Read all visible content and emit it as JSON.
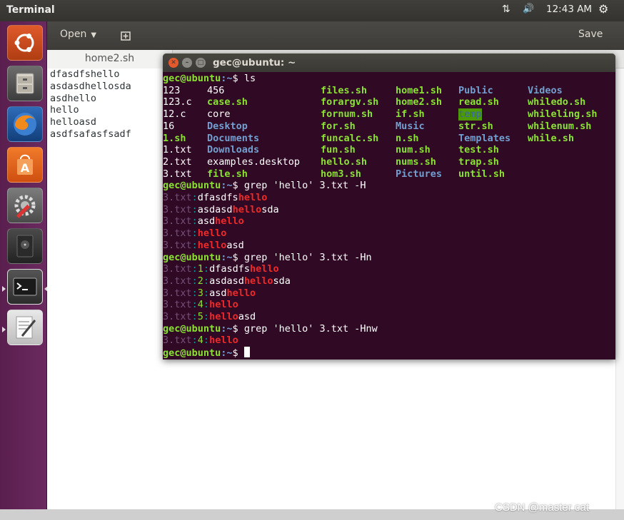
{
  "top_panel": {
    "title": "Terminal",
    "network_icon": "⇅",
    "volume_icon": "🔊",
    "time": "12:43 AM",
    "settings_icon": "⚙"
  },
  "launcher": {
    "items": [
      {
        "name": "ubuntu-dash"
      },
      {
        "name": "files"
      },
      {
        "name": "firefox"
      },
      {
        "name": "software-center"
      },
      {
        "name": "system-settings"
      },
      {
        "name": "disk"
      },
      {
        "name": "terminal"
      },
      {
        "name": "text-editor"
      }
    ]
  },
  "gedit": {
    "open_label": "Open",
    "save_label": "Save",
    "tab_label": "home2.sh",
    "lines": [
      "dfasdfshello",
      "asdasdhellosda",
      "asdhello",
      "hello",
      "helloasd",
      "asdfsafasfsadf"
    ]
  },
  "terminal": {
    "title": "gec@ubuntu: ~",
    "prompt_user": "gec@ubuntu",
    "prompt_path": ":~",
    "prompt_symbol": "$ ",
    "commands": {
      "ls": "ls",
      "grep_h": "grep 'hello' 3.txt -H",
      "grep_hn": "grep 'hello' 3.txt -Hn",
      "grep_hnw": "grep 'hello' 3.txt -Hnw"
    },
    "ls_columns": [
      [
        "123",
        "123.c",
        "12.c",
        "16",
        "1.sh",
        "1.txt",
        "2.txt",
        "3.txt"
      ],
      [
        "456",
        "case.sh",
        "core",
        "Desktop",
        "Documents",
        "Downloads",
        "examples.desktop",
        "file.sh"
      ],
      [
        "files.sh",
        "forargv.sh",
        "fornum.sh",
        "for.sh",
        "funcalc.sh",
        "fun.sh",
        "hello.sh",
        "hom3.sh"
      ],
      [
        "home1.sh",
        "home2.sh",
        "if.sh",
        "Music",
        "n.sh",
        "num.sh",
        "nums.sh",
        "Pictures"
      ],
      [
        "Public",
        "read.sh",
        "temp",
        "str.sh",
        "Templates",
        "test.sh",
        "trap.sh",
        "until.sh"
      ],
      [
        "Videos",
        "whiledo.sh",
        "whileling.sh",
        "whilenum.sh",
        "while.sh"
      ]
    ],
    "grep_h_results": [
      {
        "file": "3.txt",
        "pre": "dfasdfs",
        "match": "hello",
        "post": ""
      },
      {
        "file": "3.txt",
        "pre": "asdasd",
        "match": "hello",
        "post": "sda"
      },
      {
        "file": "3.txt",
        "pre": "asd",
        "match": "hello",
        "post": ""
      },
      {
        "file": "3.txt",
        "pre": "",
        "match": "hello",
        "post": ""
      },
      {
        "file": "3.txt",
        "pre": "",
        "match": "hello",
        "post": "asd"
      }
    ],
    "grep_hn_results": [
      {
        "file": "3.txt",
        "num": "1",
        "pre": "dfasdfs",
        "match": "hello",
        "post": ""
      },
      {
        "file": "3.txt",
        "num": "2",
        "pre": "asdasd",
        "match": "hello",
        "post": "sda"
      },
      {
        "file": "3.txt",
        "num": "3",
        "pre": "asd",
        "match": "hello",
        "post": ""
      },
      {
        "file": "3.txt",
        "num": "4",
        "pre": "",
        "match": "hello",
        "post": ""
      },
      {
        "file": "3.txt",
        "num": "5",
        "pre": "",
        "match": "hello",
        "post": "asd"
      }
    ],
    "grep_hnw_results": [
      {
        "file": "3.txt",
        "num": "4",
        "pre": "",
        "match": "hello",
        "post": ""
      }
    ]
  },
  "watermark": "CSDN @master cat",
  "colors": {
    "terminal_bg": "#300a24",
    "launcher_bg": "#5e2750",
    "green": "#8ae234",
    "blue": "#729fcf",
    "red": "#ef2929",
    "filename_purple": "#75507b",
    "separator_cyan": "#06989a"
  }
}
